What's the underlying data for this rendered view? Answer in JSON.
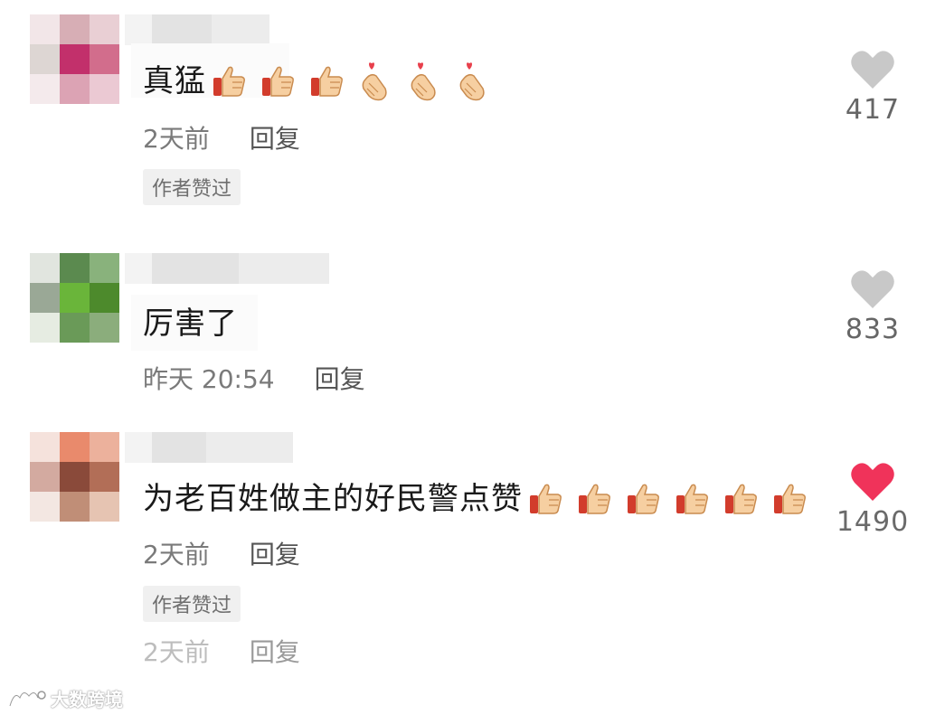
{
  "comments": [
    {
      "text": "真猛",
      "emojis": [
        "thumbs-up",
        "thumbs-up",
        "thumbs-up",
        "finger-heart",
        "finger-heart",
        "finger-heart"
      ],
      "time": "2天前",
      "reply_label": "回复",
      "badge": "作者赞过",
      "like_count": "417",
      "liked": false
    },
    {
      "text": "厉害了",
      "emojis": [],
      "time": "昨天 20:54",
      "reply_label": "回复",
      "badge": "",
      "like_count": "833",
      "liked": false
    },
    {
      "text": "为老百姓做主的好民警点赞",
      "emojis": [
        "thumbs-up",
        "thumbs-up",
        "thumbs-up",
        "thumbs-up",
        "thumbs-up",
        "thumbs-up"
      ],
      "time": "2天前",
      "reply_label": "回复",
      "badge": "作者赞过",
      "like_count": "1490",
      "liked": true
    }
  ],
  "partial_comment": {
    "time": "2天前",
    "reply_label": "回复"
  },
  "watermark": "大数跨境",
  "colors": {
    "like_inactive": "#c8c8c8",
    "like_active": "#f0335a",
    "badge_bg": "#f0f0f0"
  }
}
